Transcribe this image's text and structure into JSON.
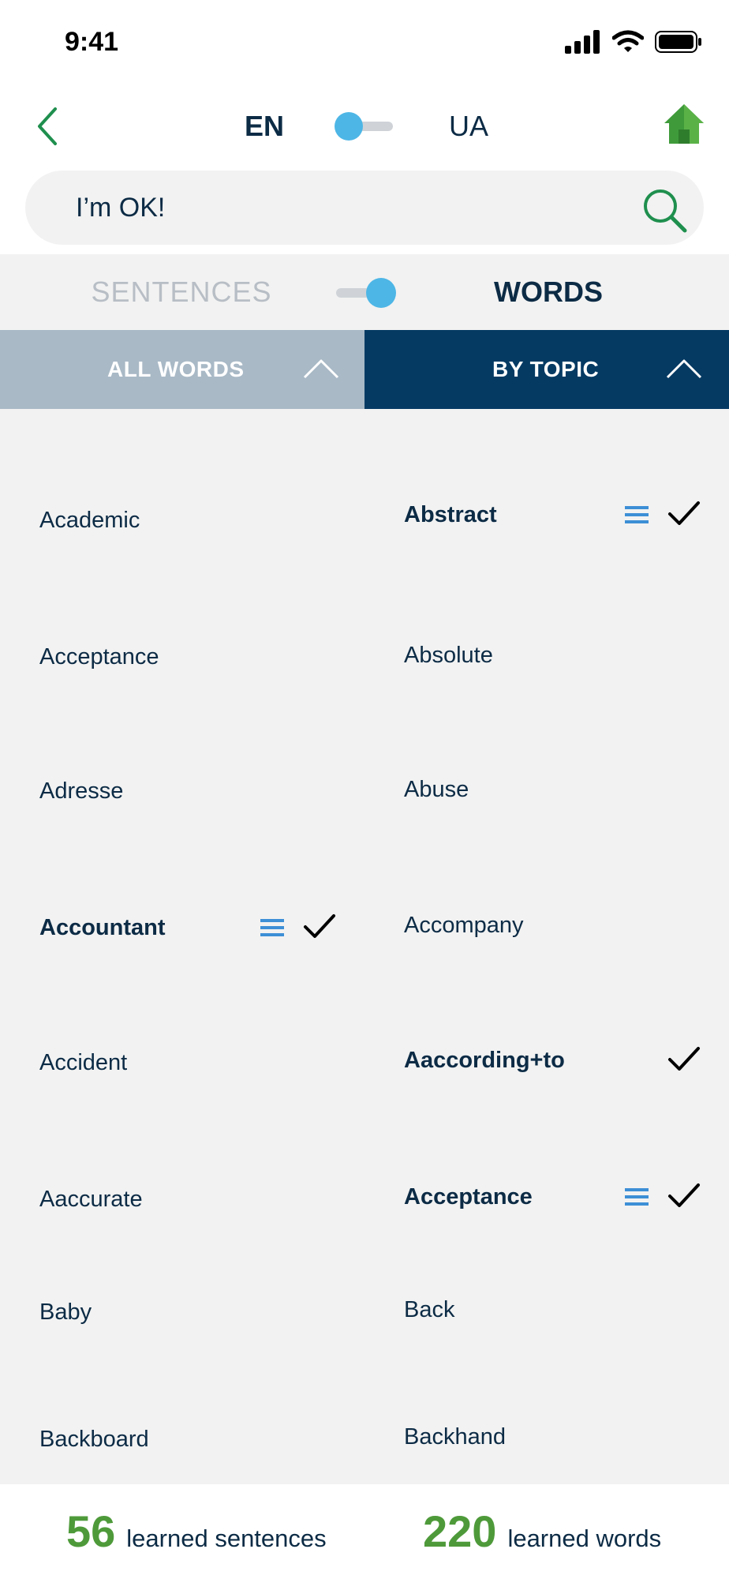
{
  "status_bar": {
    "time": "9:41",
    "icons": [
      "cellular-signal-icon",
      "wifi-icon",
      "battery-icon"
    ]
  },
  "header": {
    "back_icon": "chevron-left-icon",
    "lang_from": "EN",
    "lang_to": "UA",
    "lang_toggle_on": false,
    "home_icon": "home-icon"
  },
  "search": {
    "value": "I’m OK!",
    "icon": "search-icon"
  },
  "mode": {
    "sentences_label": "SENTENCES",
    "words_label": "WORDS",
    "active": "words"
  },
  "tabs": {
    "all_words": "ALL WORDS",
    "by_topic": "BY TOPIC",
    "active": "by_topic"
  },
  "list": {
    "left": [
      {
        "label": "Academic",
        "learned": false,
        "menu": false,
        "check": false
      },
      {
        "label": "Acceptance",
        "learned": false,
        "menu": false,
        "check": false
      },
      {
        "label": "Adresse",
        "learned": false,
        "menu": false,
        "check": false
      },
      {
        "label": "Accountant",
        "learned": true,
        "menu": true,
        "check": true
      },
      {
        "label": "Accident",
        "learned": false,
        "menu": false,
        "check": false
      },
      {
        "label": "Aaccurate",
        "learned": false,
        "menu": false,
        "check": false
      },
      {
        "label": "Baby",
        "learned": false,
        "menu": false,
        "check": false
      },
      {
        "label": "Backboard",
        "learned": false,
        "menu": false,
        "check": false
      }
    ],
    "right": [
      {
        "label": "Abstract",
        "learned": true,
        "menu": true,
        "check": true
      },
      {
        "label": "Absolute",
        "learned": false,
        "menu": false,
        "check": false
      },
      {
        "label": "Abuse",
        "learned": false,
        "menu": false,
        "check": false
      },
      {
        "label": "Accompany",
        "learned": false,
        "menu": false,
        "check": false
      },
      {
        "label": "Aaccording+to",
        "learned": true,
        "menu": false,
        "check": true
      },
      {
        "label": "Acceptance",
        "learned": true,
        "menu": true,
        "check": true
      },
      {
        "label": "Back",
        "learned": false,
        "menu": false,
        "check": false
      },
      {
        "label": "Backhand",
        "learned": false,
        "menu": false,
        "check": false
      }
    ]
  },
  "footer": {
    "sentences_count": "56",
    "sentences_label": "learned sentences",
    "words_count": "220",
    "words_label": "learned words"
  },
  "colors": {
    "navy": "#0c2b45",
    "tab_active": "#053a63",
    "tab_inactive": "#a9b9c6",
    "toggle_knob": "#4db6e6",
    "green_accent": "#4e9a3a",
    "list_bg": "#f2f2f2"
  }
}
